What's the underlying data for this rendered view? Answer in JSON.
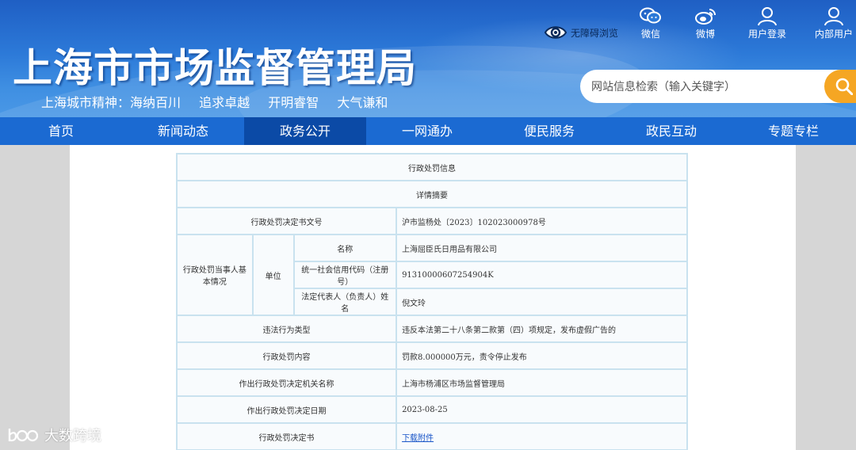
{
  "header": {
    "site_title": "上海市市场监督管理局",
    "slogan": [
      "上海城市精神：海纳百川",
      "追求卓越",
      "开明睿智",
      "大气谦和"
    ],
    "accessibility_label": "无障碍浏览",
    "tools": [
      {
        "label": "微信",
        "icon": "wechat-icon"
      },
      {
        "label": "微博",
        "icon": "weibo-icon"
      },
      {
        "label": "用户登录",
        "icon": "user-icon"
      },
      {
        "label": "内部用户",
        "icon": "user-icon"
      }
    ],
    "search_placeholder": "网站信息检索（输入关键字）"
  },
  "nav": {
    "items": [
      "首页",
      "新闻动态",
      "政务公开",
      "一网通办",
      "便民服务",
      "政民互动",
      "专题专栏"
    ],
    "active": "政务公开"
  },
  "detail": {
    "title": "行政处罚信息",
    "subtitle": "详情摘要",
    "decision_no_label": "行政处罚决定书文号",
    "decision_no": "沪市监杨处〔2023〕102023000978号",
    "party_label": "行政处罚当事人基本情况",
    "unit_label": "单位",
    "name_label": "名称",
    "name": "上海屈臣氏日用品有限公司",
    "credit_code_label": "统一社会信用代码（注册号）",
    "credit_code": "91310000607254904K",
    "legal_rep_label": "法定代表人（负责人）姓名",
    "legal_rep": "倪文玲",
    "violation_type_label": "违法行为类型",
    "violation_type": "违反本法第二十八条第二款第（四）项规定，发布虚假广告的",
    "penalty_label": "行政处罚内容",
    "penalty": "罚款8.000000万元，责令停止发布",
    "authority_label": "作出行政处罚决定机关名称",
    "authority": "上海市杨浦区市场监督管理局",
    "date_label": "作出行政处罚决定日期",
    "date": "2023-08-25",
    "document_label": "行政处罚决定书",
    "document_link": "下载附件"
  },
  "watermark": "大数跨境",
  "colors": {
    "header_blue": "#2c79d8",
    "nav_blue": "#1b6ad2",
    "nav_active": "#0b4aa6",
    "search_button": "#f5a623",
    "table_border": "#c9e2ef",
    "link": "#1a56c8"
  }
}
